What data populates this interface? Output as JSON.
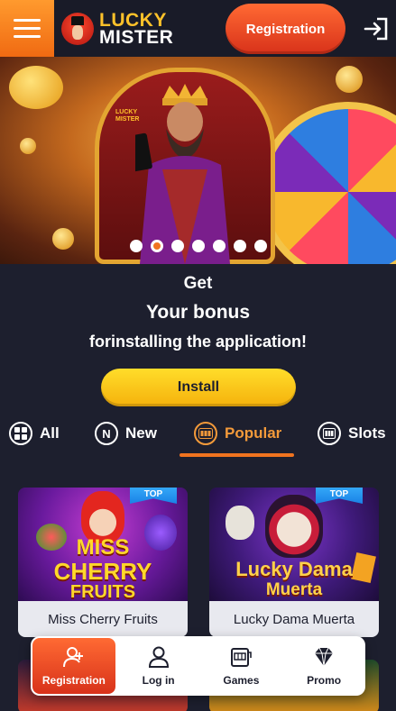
{
  "header": {
    "logo_line1": "LUCKY",
    "logo_line2": "MISTER",
    "registration_label": "Registration"
  },
  "banner": {
    "slide_count": 7,
    "active_slide": 2,
    "phone_logo": "LUCKY MISTER"
  },
  "bonus": {
    "line1": "Get",
    "line2": "Your bonus",
    "line3": "forinstalling the application!",
    "install_label": "Install"
  },
  "tabs": [
    {
      "label": "All",
      "icon": "grid-icon"
    },
    {
      "label": "New",
      "icon": "new-n-icon"
    },
    {
      "label": "Popular",
      "icon": "slot-machine-icon",
      "active": true
    },
    {
      "label": "Slots",
      "icon": "slots-icon"
    }
  ],
  "games": [
    {
      "title": "Miss Cherry Fruits",
      "badge": "TOP",
      "thumb_line1": "MISS",
      "thumb_line2": "CHERRY",
      "thumb_line3": "FRUITS"
    },
    {
      "title": "Lucky Dama Muerta",
      "badge": "TOP",
      "thumb_line1": "Lucky Dama",
      "thumb_line2": "Muerta"
    }
  ],
  "bottom_nav": [
    {
      "label": "Registration",
      "icon": "add-user-icon",
      "active": true
    },
    {
      "label": "Log in",
      "icon": "user-icon"
    },
    {
      "label": "Games",
      "icon": "slot-machine-icon"
    },
    {
      "label": "Promo",
      "icon": "diamond-icon"
    }
  ],
  "colors": {
    "background": "#1d1f2e",
    "accent_orange": "#f0731f",
    "install_yellow": "#ffd21f",
    "badge_blue": "#2a93ef"
  }
}
